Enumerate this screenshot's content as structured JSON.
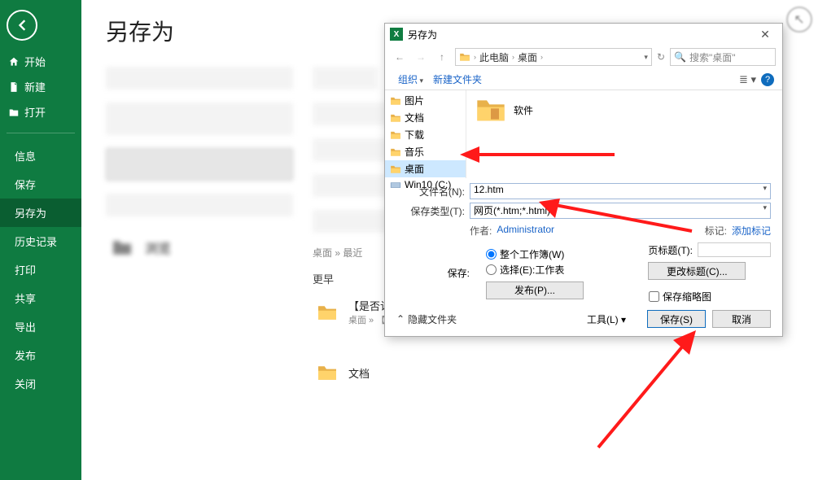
{
  "sidebar": {
    "nav_home": "开始",
    "nav_new": "新建",
    "nav_open": "打开",
    "nav_info": "信息",
    "nav_save": "保存",
    "nav_saveas": "另存为",
    "nav_history": "历史记录",
    "nav_print": "打印",
    "nav_share": "共享",
    "nav_export": "导出",
    "nav_publish": "发布",
    "nav_close": "关闭"
  },
  "backstage": {
    "title": "另存为",
    "browse": "浏览",
    "earlier": "更早",
    "recent1_name": "【是否认",
    "recent1_path": "桌面 » 【是",
    "recent2_name": "文档",
    "recent_path_label": "桌面 » 最近"
  },
  "dialog": {
    "title": "另存为",
    "bc_pc": "此电脑",
    "bc_desktop": "桌面",
    "search_placeholder": "搜索\"桌面\"",
    "organize": "组织",
    "newfolder": "新建文件夹",
    "tree_pictures": "图片",
    "tree_documents": "文档",
    "tree_downloads": "下载",
    "tree_music": "音乐",
    "tree_desktop": "桌面",
    "tree_win10": "Win10 (C:)",
    "file_soft": "软件",
    "filename_label": "文件名(N):",
    "filename_value": "12.htm",
    "filetype_label": "保存类型(T):",
    "filetype_value": "网页(*.htm;*.html)",
    "author_label": "作者:",
    "author_value": "Administrator",
    "tags_label": "标记:",
    "tags_value": "添加标记",
    "save_label": "保存:",
    "radio_whole": "整个工作簿(W)",
    "radio_select": "选择(E):工作表",
    "publish_btn": "发布(P)...",
    "pagetitle_label": "页标题(T):",
    "changetitle_btn": "更改标题(C)...",
    "thumb_label": "保存缩略图",
    "hidefolders": "隐藏文件夹",
    "tools": "工具(L)",
    "save_btn": "保存(S)",
    "cancel_btn": "取消"
  }
}
